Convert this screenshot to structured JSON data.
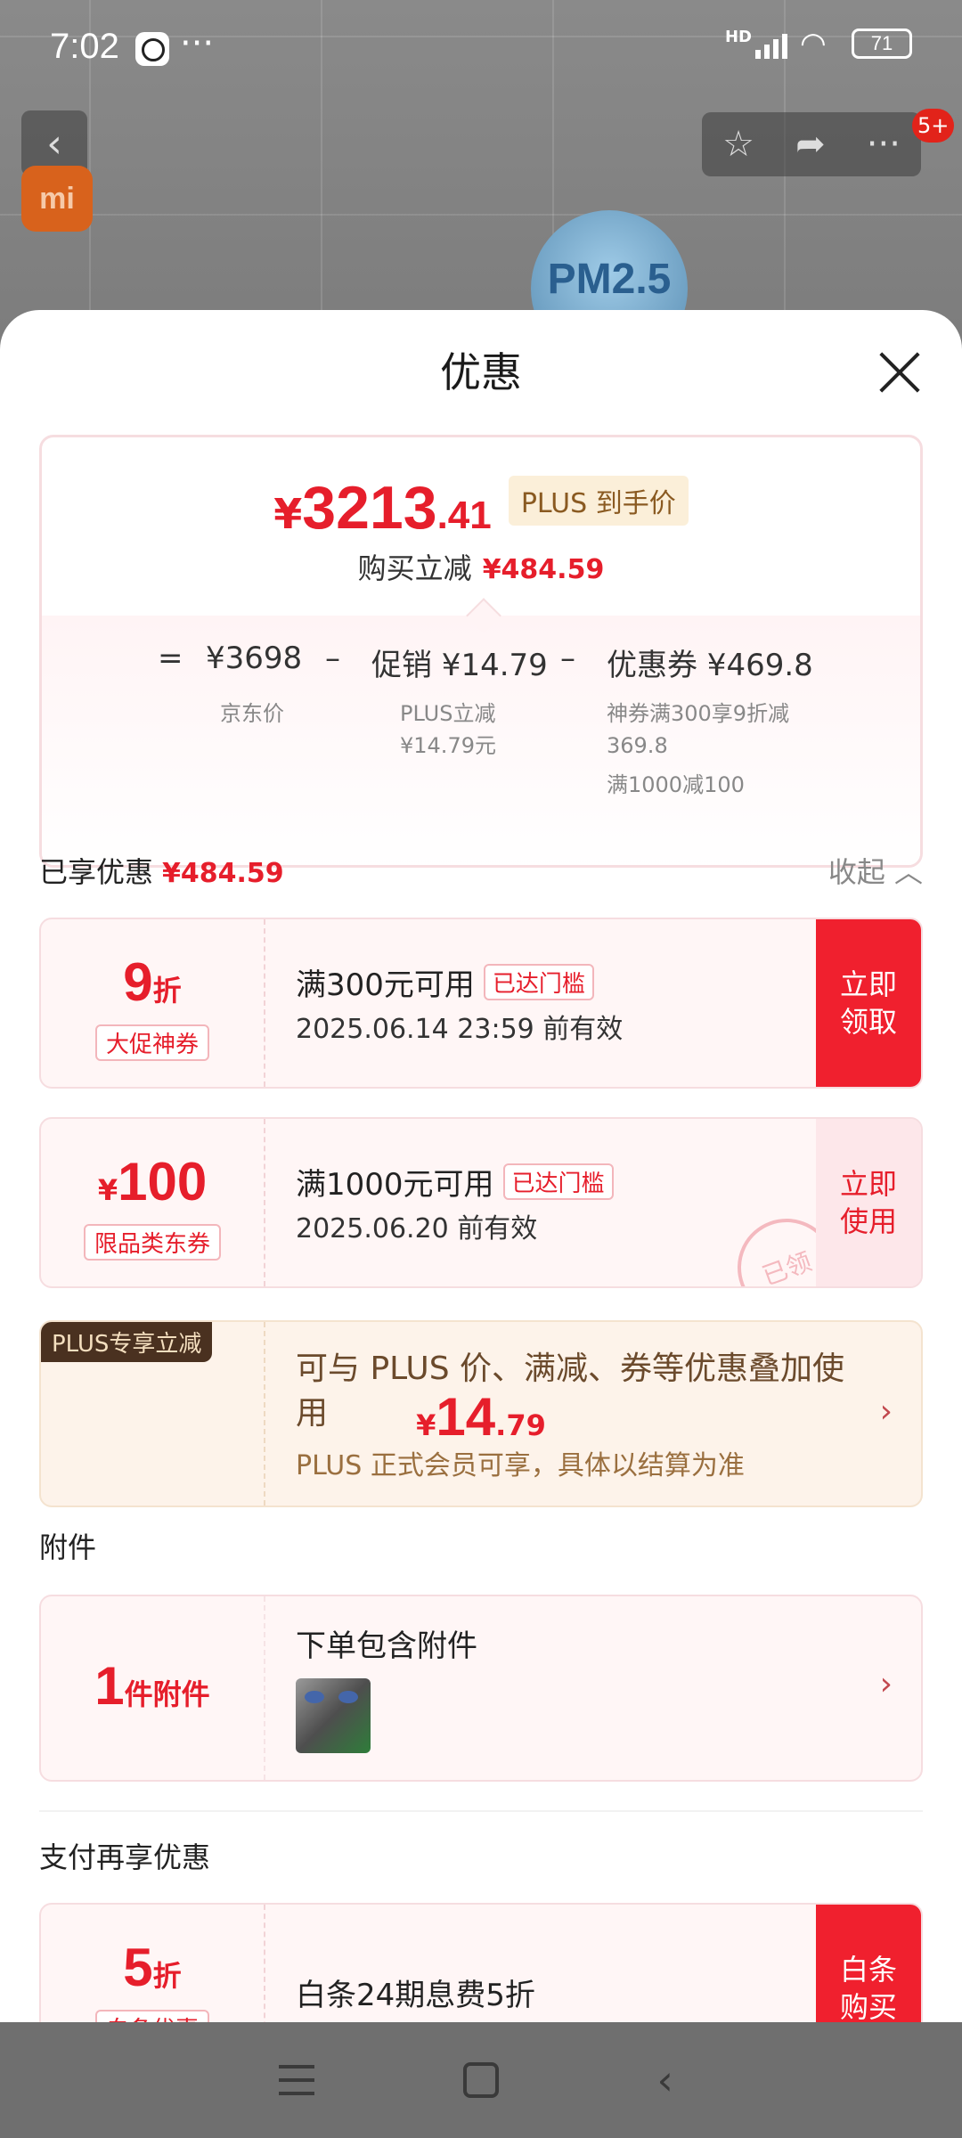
{
  "status_bar": {
    "time": "7:02",
    "dots": "···",
    "network": "HD",
    "battery": "71"
  },
  "background": {
    "brand": "mi",
    "pm_badge": "PM2.5",
    "cart_count": "5+"
  },
  "sheet": {
    "title": "优惠",
    "price": {
      "yen": "¥",
      "integer": "3213",
      "decimal": ".41",
      "plus_tag": "PLUS 到手价",
      "sub_label": "购买立减",
      "sub_value": "¥484.59"
    },
    "formula": {
      "eq": "=",
      "jd_price": "¥3698",
      "minus1": "–",
      "promo": "促销 ¥14.79",
      "minus2": "–",
      "coupon": "优惠券 ¥469.8",
      "jd_price_label": "京东价",
      "promo_label_1": "PLUS立减",
      "promo_label_2": "¥14.79元",
      "coupon_label_1": "神券满300享9折减",
      "coupon_label_2": "369.8",
      "coupon_label_3": "满1000减100"
    },
    "enjoyed": {
      "label": "已享优惠",
      "value": "¥484.59",
      "collapse": "收起 ︿"
    },
    "coupons": [
      {
        "value_big": "9",
        "value_small": "折",
        "tag": "大促神券",
        "title": "满300元可用",
        "reach": "已达门槛",
        "date": "2025.06.14 23:59 前有效",
        "button_line1": "立即",
        "button_line2": "领取"
      },
      {
        "value_prefix": "¥",
        "value_big": "100",
        "tag": "限品类东券",
        "title": "满1000元可用",
        "reach": "已达门槛",
        "date": "2025.06.20 前有效",
        "button_line1": "立即",
        "button_line2": "使用",
        "stamp": "已领"
      }
    ],
    "plus_card": {
      "ribbon": "PLUS专享立减",
      "yen": "¥",
      "value_big": "14",
      "value_small": ".79",
      "main": "可与 PLUS 价、满减、券等优惠叠加使用",
      "sub": "PLUS 正式会员可享，具体以结算为准",
      "chevron": "›"
    },
    "accessory_section": {
      "title": "附件",
      "value_big": "1",
      "value_small": "件附件",
      "main": "下单包含附件",
      "chevron": "›"
    },
    "payment_section": {
      "title": "支付再享优惠",
      "value_big": "5",
      "value_small": "折",
      "tag": "白条优惠",
      "main": "白条24期息费5折",
      "button_line1": "白条",
      "button_line2": "购买"
    }
  }
}
